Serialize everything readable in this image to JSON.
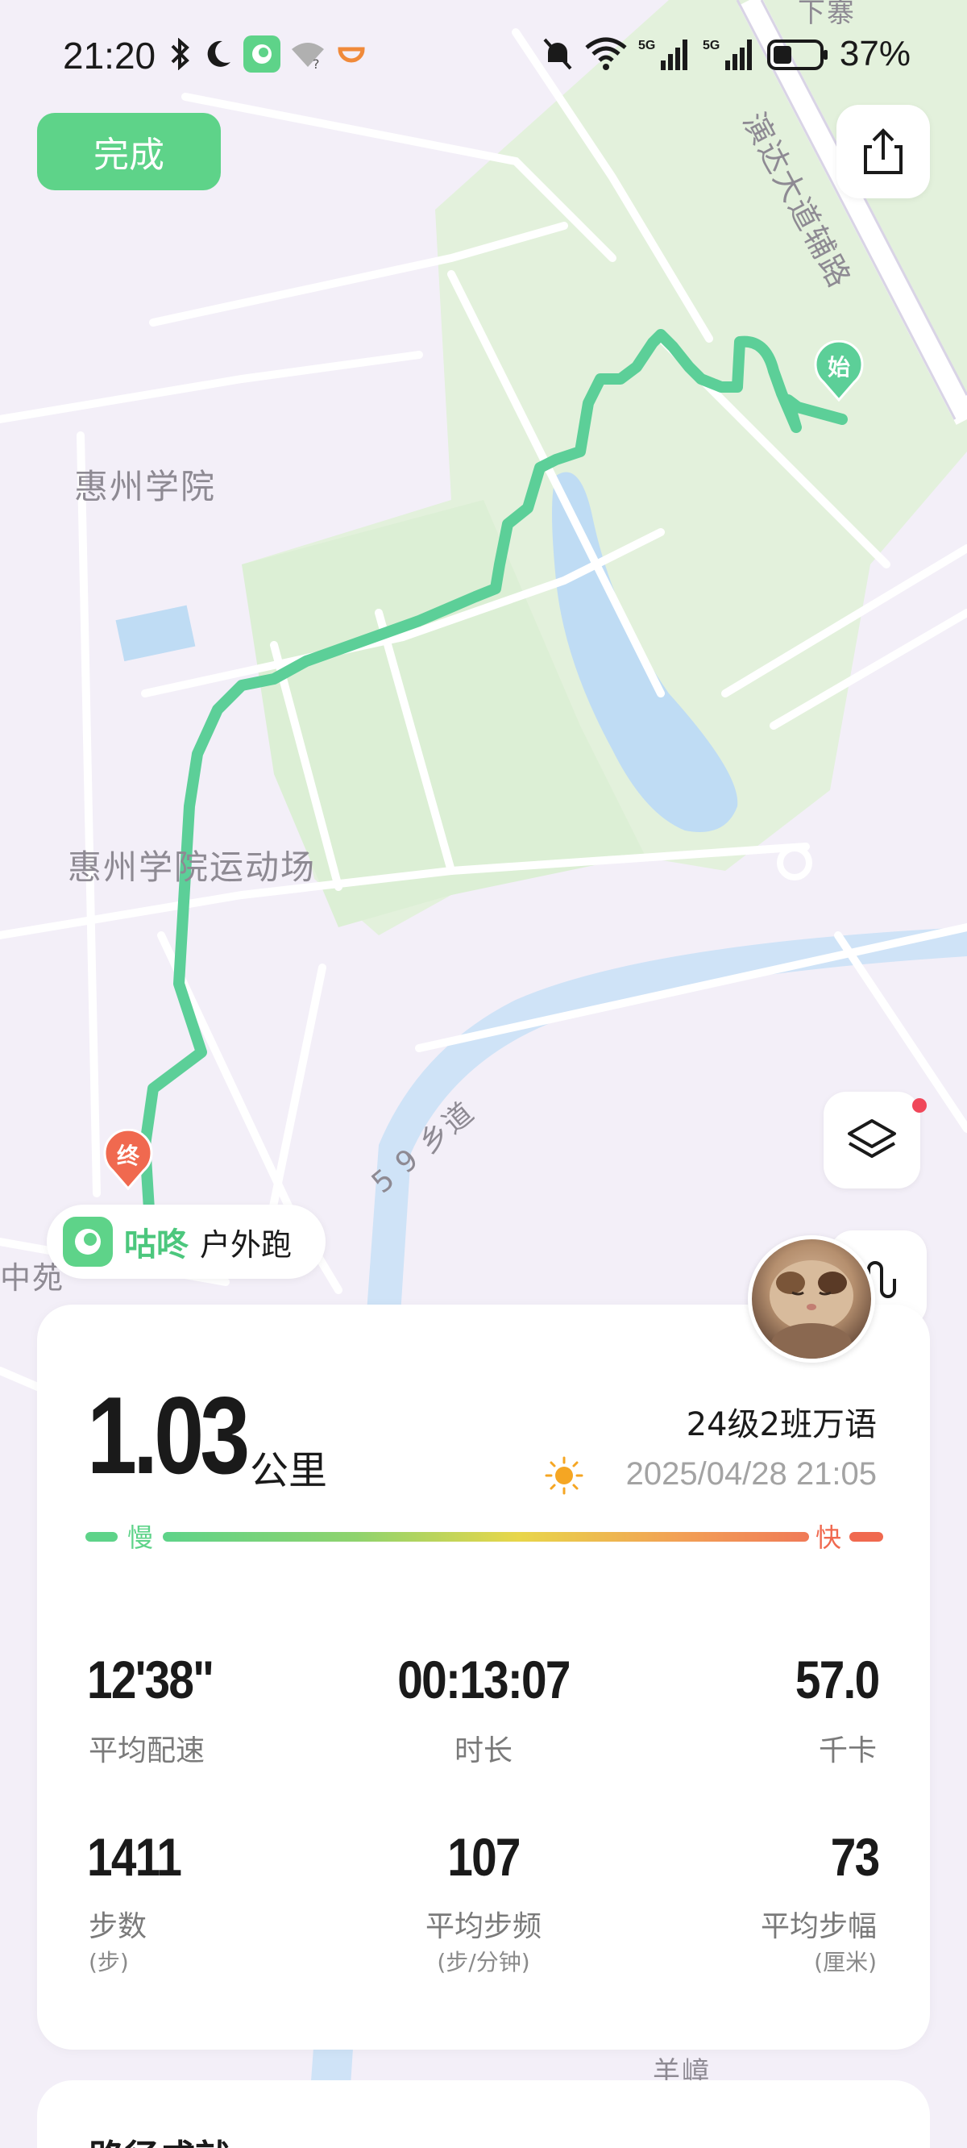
{
  "status_bar": {
    "time": "21:20",
    "battery": "37%"
  },
  "header": {
    "done_label": "完成"
  },
  "map": {
    "labels": {
      "campus": "惠州学院",
      "stadium": "惠州学院运动场",
      "road_main": "演达大道辅路",
      "road_59": "5 9 乡道",
      "bottom_place": "羊嶂",
      "left_place": "中苑",
      "top_place": "下寨"
    },
    "start_marker": "始",
    "end_marker": "终"
  },
  "brand": {
    "name": "咕咚",
    "activity": "户外跑"
  },
  "summary": {
    "distance": "1.03",
    "distance_unit": "公里",
    "username": "24级2班万语",
    "datetime": "2025/04/28 21:05",
    "pace_slow": "慢",
    "pace_fast": "快"
  },
  "stats": [
    {
      "value": "12'38\"",
      "label": "平均配速",
      "unit": ""
    },
    {
      "value": "00:13:07",
      "label": "时长",
      "unit": ""
    },
    {
      "value": "57.0",
      "label": "千卡",
      "unit": ""
    },
    {
      "value": "1411",
      "label": "步数",
      "unit": "(步)"
    },
    {
      "value": "107",
      "label": "平均步频",
      "unit": "(步/分钟)"
    },
    {
      "value": "73",
      "label": "平均步幅",
      "unit": "(厘米)"
    }
  ],
  "colors": {
    "brand_green": "#5ed389",
    "route_green": "#5ccf98",
    "fast_red": "#f0694f",
    "end_marker": "#f0694f"
  },
  "bottom_section": {
    "title": "路径成就"
  }
}
